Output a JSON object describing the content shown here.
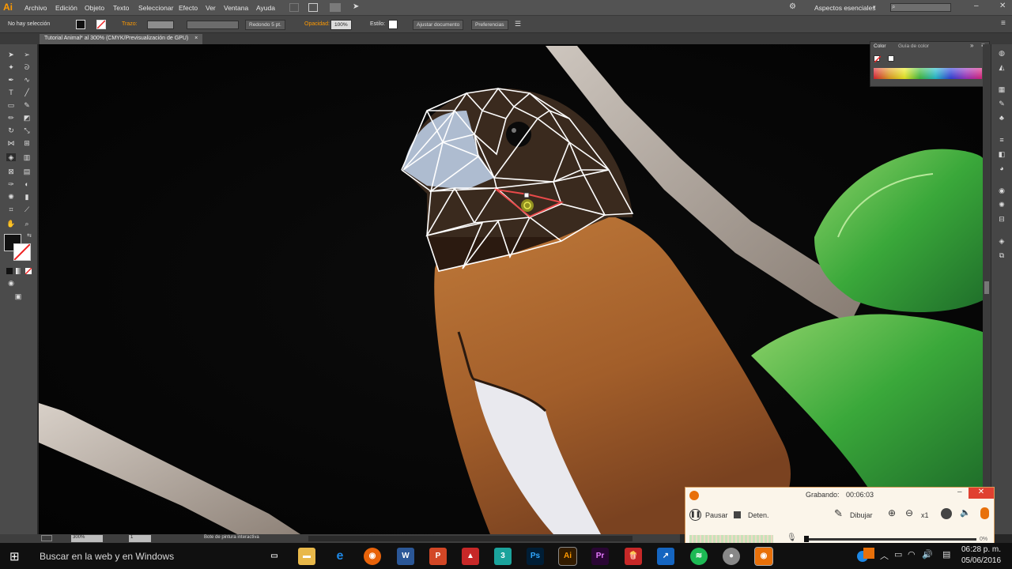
{
  "app": {
    "logo": "Ai"
  },
  "menu": {
    "items": [
      "Archivo",
      "Edición",
      "Objeto",
      "Texto",
      "Seleccionar",
      "Efecto",
      "Ver",
      "Ventana",
      "Ayuda"
    ],
    "workspace": "Aspectos esenciales"
  },
  "control": {
    "selection": "No hay selección",
    "stroke_label": "Trazo:",
    "brush": "Redondo 5 pt.",
    "opacity_label": "Opacidad:",
    "opacity_value": "100%",
    "style_label": "Estilo:",
    "doc_setup": "Ajustar documento",
    "prefs": "Preferencias"
  },
  "document": {
    "tab": "Tutorial Animal* al 300% (CMYK/Previsualización de GPU)",
    "close": "×"
  },
  "color_panel": {
    "tab1": "Color",
    "tab2": "Guía de color"
  },
  "status": {
    "zoom": "300%",
    "page": "1",
    "tool": "Bote de pintura interactiva"
  },
  "recorder": {
    "title": "Grabando:",
    "time": "00:06:03",
    "pause": "Pausar",
    "stop": "Deten.",
    "draw": "Dibujar",
    "zoom_mult": "x1",
    "progress": "0%"
  },
  "taskbar": {
    "search": "Buscar en la web y en Windows",
    "time": "06:28 p. m.",
    "date": "05/06/2016"
  },
  "colors": {
    "accent": "#ff9a00",
    "recorder_orange": "#e8700a",
    "selection_red": "#e84a4a"
  }
}
